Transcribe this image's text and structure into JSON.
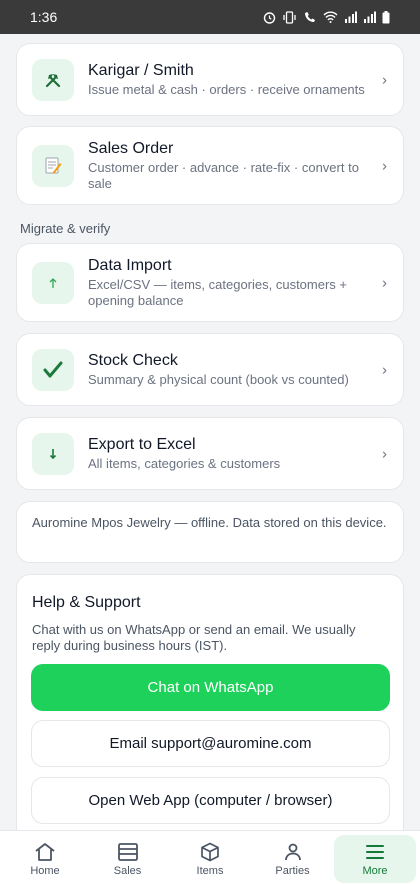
{
  "status_bar": {
    "time": "1:36"
  },
  "cards": [
    {
      "title": "Karigar / Smith",
      "subtitle": "Issue metal & cash · orders · receive ornaments",
      "icon": "hammer-pick-icon"
    },
    {
      "title": "Sales Order",
      "subtitle": "Customer order · advance · rate-fix · convert to sale",
      "icon": "memo-icon"
    }
  ],
  "section_label": "Migrate & verify",
  "migrate_cards": [
    {
      "title": "Data Import",
      "subtitle": "Excel/CSV — items, categories, customers + opening balance",
      "icon": "upload-icon"
    },
    {
      "title": "Stock Check",
      "subtitle": "Summary & physical count (book vs counted)",
      "icon": "check-mark-icon"
    },
    {
      "title": "Export to Excel",
      "subtitle": "All items, categories & customers",
      "icon": "download-arrow-icon"
    }
  ],
  "info_text": "Auromine Mpos Jewelry — offline. Data stored on this device.",
  "help": {
    "title": "Help & Support",
    "description": "Chat with us on WhatsApp or send an email. We usually reply during business hours (IST).",
    "whatsapp_label": "Chat on WhatsApp",
    "email_label": "Email support@auromine.com",
    "web_label": "Open Web App (computer / browser)"
  },
  "nav": [
    {
      "label": "Home",
      "icon": "home-icon"
    },
    {
      "label": "Sales",
      "icon": "sales-icon"
    },
    {
      "label": "Items",
      "icon": "box-icon"
    },
    {
      "label": "Parties",
      "icon": "person-icon"
    },
    {
      "label": "More",
      "icon": "menu-icon",
      "active": true
    }
  ],
  "colors": {
    "accent": "#1dd15b",
    "accent_dark": "#147a37",
    "icon_bg": "#e6f6ec"
  }
}
